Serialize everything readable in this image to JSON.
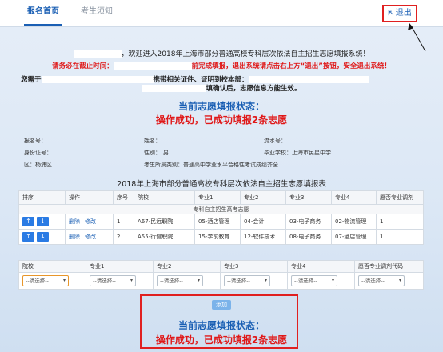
{
  "tabs": [
    {
      "label": "报名首页",
      "active": true
    },
    {
      "label": "考生须知",
      "active": false
    }
  ],
  "logout": {
    "label": "退出",
    "icon": "logout-icon"
  },
  "welcome": {
    "text": "，欢迎进入2018年上海市部分普通高校专科层次依法自主招生志愿填报系统！"
  },
  "deadline": {
    "prefix": "请务必在截止时间：",
    "suffix": "前完成填报，退出系统请点击右上方“退出”按钮，安全退出系统！"
  },
  "notice": {
    "prefix": "您需于",
    "suffix": "携带相关证件、证明到校本部：",
    "line2": "填确认后，志愿信息方能生效。"
  },
  "status": {
    "title": "当前志愿填报状态：",
    "message": "操作成功，已成功填报2条志愿"
  },
  "info": {
    "reg_no_label": "报名号：",
    "name_label": "姓名：",
    "flow_label": "流水号：",
    "id_label": "身份证号：",
    "gender_label": "性别：",
    "gender_value": "男",
    "school_label": "毕业学校：",
    "school_value": "上海市民星中学",
    "district_label": "区：",
    "district_value": "杨浦区",
    "category_label": "考生所属类别：",
    "category_value": "普通高中学业水平合格性考试成绩齐全"
  },
  "table_title": "2018年上海市部分普通高校专科层次依法自主招生志愿填报表",
  "table": {
    "headers": [
      "排序",
      "操作",
      "序号",
      "院校",
      "专业1",
      "专业2",
      "专业3",
      "专业4",
      "愿否专业调剂"
    ],
    "group_label": "专科自主招生高考志愿",
    "move_up": "↑",
    "move_down": "↓",
    "delete_label": "删除",
    "edit_label": "修改",
    "rows": [
      {
        "no": "1",
        "school": "A67-民远职院",
        "m1": "05-酒店管理",
        "m2": "04-会计",
        "m3": "03-电子商务",
        "m4": "02-物流管理",
        "adjust": "1"
      },
      {
        "no": "2",
        "school": "A55-行健职院",
        "m1": "15-学前教育",
        "m2": "12-软件技术",
        "m3": "08-电子商务",
        "m4": "07-酒店管理",
        "adjust": "1"
      }
    ]
  },
  "form": {
    "headers": [
      "院校",
      "专业1",
      "专业2",
      "专业3",
      "专业4",
      "愿否专业调剂代码"
    ],
    "placeholder": "--请选择--"
  },
  "add_button": "添加"
}
